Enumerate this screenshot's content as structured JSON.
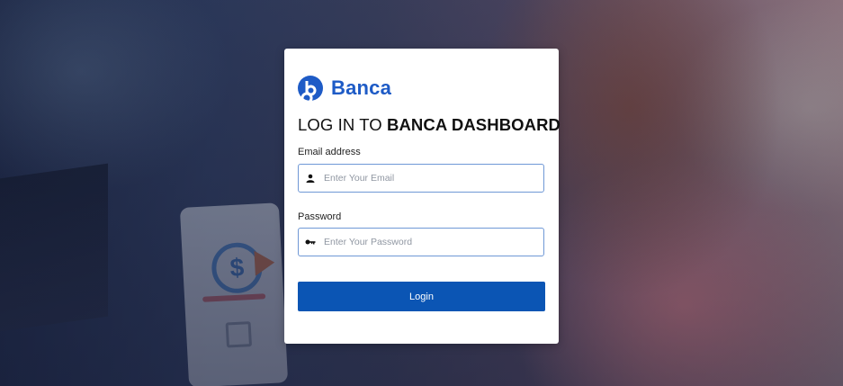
{
  "brand": {
    "name": "Banca",
    "logo_icon": "banca-logo-icon",
    "color": "#1e5bc6"
  },
  "form": {
    "title_prefix": "LOG IN TO ",
    "title_bold": "BANCA DASHBOARD",
    "email": {
      "label": "Email address",
      "placeholder": "Enter Your Email",
      "value": "",
      "icon": "user-icon"
    },
    "password": {
      "label": "Password",
      "placeholder": "Enter Your Password",
      "value": "",
      "icon": "key-icon"
    },
    "submit_label": "Login",
    "accent_color": "#0b55b4"
  }
}
